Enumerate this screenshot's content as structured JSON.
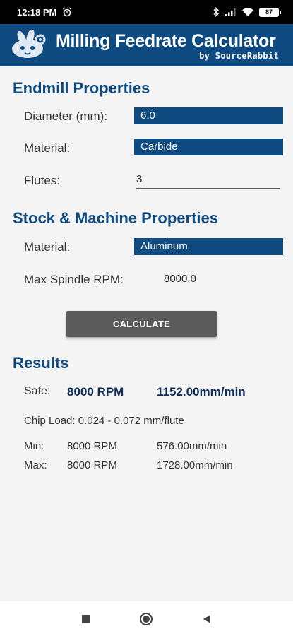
{
  "status_bar": {
    "time": "12:18 PM",
    "battery": "87",
    "icons": [
      "alarm-icon",
      "bluetooth-icon",
      "signal-icon",
      "wifi-icon",
      "battery-icon"
    ]
  },
  "header": {
    "title": "Milling Feedrate Calculator",
    "subtitle": "by SourceRabbit"
  },
  "endmill": {
    "section_title": "Endmill Properties",
    "diameter_label": "Diameter (mm):",
    "diameter_value": "6.0",
    "material_label": "Material:",
    "material_value": "Carbide",
    "flutes_label": "Flutes:",
    "flutes_value": "3"
  },
  "stock": {
    "section_title": "Stock & Machine Properties",
    "material_label": "Material:",
    "material_value": "Aluminum",
    "rpm_label": "Max Spindle RPM:",
    "rpm_value": "8000.0"
  },
  "calculate_button": "CALCULATE",
  "results": {
    "section_title": "Results",
    "safe_label": "Safe:",
    "safe_rpm": "8000 RPM",
    "safe_feed": "1152.00mm/min",
    "chip_load": "Chip Load: 0.024 - 0.072 mm/flute",
    "min_label": "Min:",
    "min_rpm": "8000 RPM",
    "min_feed": "576.00mm/min",
    "max_label": "Max:",
    "max_rpm": "8000 RPM",
    "max_feed": "1728.00mm/min"
  },
  "colors": {
    "brand": "#0f4a80",
    "button": "#5b5b5b",
    "background": "#f4f4f4"
  }
}
